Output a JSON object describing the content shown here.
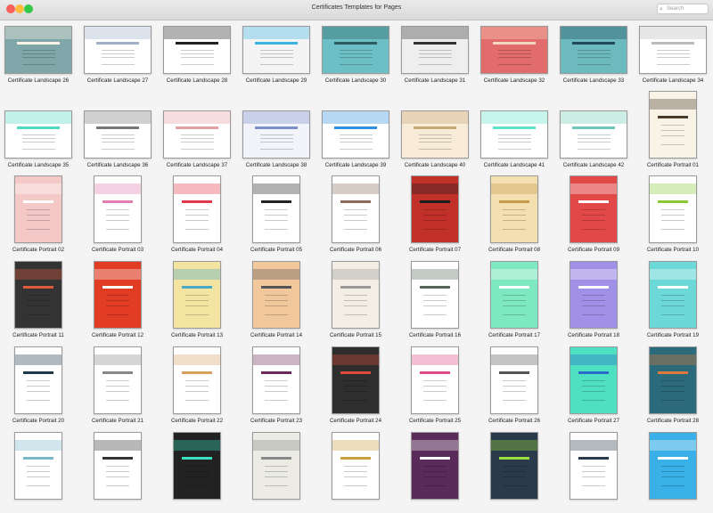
{
  "window": {
    "title": "Certificates Templates for Pages",
    "search_placeholder": "Search",
    "traffic_lights": {
      "close": "#fc605b",
      "minimize": "#fdbc40",
      "zoom": "#34c84a"
    }
  },
  "rows": [
    [
      {
        "label": "Certificate Landscape 26",
        "kind": "landscape",
        "bg": "#7fa7a9",
        "accent": "#fdf3e6"
      },
      {
        "label": "Certificate Landscape 27",
        "kind": "landscape",
        "bg": "#ffffff",
        "accent": "#9fb0c8"
      },
      {
        "label": "Certificate Landscape 28",
        "kind": "landscape",
        "bg": "#ffffff",
        "accent": "#222222"
      },
      {
        "label": "Certificate Landscape 29",
        "kind": "landscape",
        "bg": "#f4f4f4",
        "accent": "#3bb3e0"
      },
      {
        "label": "Certificate Landscape 30",
        "kind": "landscape",
        "bg": "#6cc0c5",
        "accent": "#2d5b5e"
      },
      {
        "label": "Certificate Landscape 31",
        "kind": "landscape",
        "bg": "#eeeeee",
        "accent": "#333333"
      },
      {
        "label": "Certificate Landscape 32",
        "kind": "landscape",
        "bg": "#e26b6b",
        "accent": "#f6d7c2"
      },
      {
        "label": "Certificate Landscape 33",
        "kind": "landscape",
        "bg": "#6cbabd",
        "accent": "#22475a"
      },
      {
        "label": "Certificate Landscape 34",
        "kind": "landscape",
        "bg": "#ffffff",
        "accent": "#bbbbbb"
      }
    ],
    [
      {
        "label": "Certificate Landscape 35",
        "kind": "landscape",
        "bg": "#ffffff",
        "accent": "#4fd8c2"
      },
      {
        "label": "Certificate Landscape 36",
        "kind": "landscape",
        "bg": "#ffffff",
        "accent": "#777777"
      },
      {
        "label": "Certificate Landscape 37",
        "kind": "landscape",
        "bg": "#ffffff",
        "accent": "#e4a0a0"
      },
      {
        "label": "Certificate Landscape 38",
        "kind": "landscape",
        "bg": "#f2f4fa",
        "accent": "#7b8fc8"
      },
      {
        "label": "Certificate Landscape 39",
        "kind": "landscape",
        "bg": "#ffffff",
        "accent": "#2f8fe0"
      },
      {
        "label": "Certificate Landscape 40",
        "kind": "landscape",
        "bg": "#f8ecd8",
        "accent": "#c8a878"
      },
      {
        "label": "Certificate Landscape 41",
        "kind": "landscape",
        "bg": "#ffffff",
        "accent": "#5ee2c8"
      },
      {
        "label": "Certificate Landscape 42",
        "kind": "landscape",
        "bg": "#ffffff",
        "accent": "#6cc8b8"
      },
      {
        "label": "Certificate Portrait 01",
        "kind": "portrait",
        "bg": "#f8f3e6",
        "accent": "#4a3a2a"
      }
    ],
    [
      {
        "label": "Certificate Portrait 02",
        "kind": "portrait",
        "bg": "#f5c8c8",
        "accent": "#ffffff"
      },
      {
        "label": "Certificate Portrait 03",
        "kind": "portrait",
        "bg": "#ffffff",
        "accent": "#e07fb0"
      },
      {
        "label": "Certificate Portrait 04",
        "kind": "portrait",
        "bg": "#ffffff",
        "accent": "#e03a4a"
      },
      {
        "label": "Certificate Portrait 05",
        "kind": "portrait",
        "bg": "#ffffff",
        "accent": "#222222"
      },
      {
        "label": "Certificate Portrait 06",
        "kind": "portrait",
        "bg": "#ffffff",
        "accent": "#8a6a5a"
      },
      {
        "label": "Certificate Portrait 07",
        "kind": "portrait",
        "bg": "#c2302a",
        "accent": "#1e1e1e"
      },
      {
        "label": "Certificate Portrait 08",
        "kind": "portrait",
        "bg": "#f3dfb0",
        "accent": "#c89a4a"
      },
      {
        "label": "Certificate Portrait 09",
        "kind": "portrait",
        "bg": "#e24848",
        "accent": "#ffffff"
      },
      {
        "label": "Certificate Portrait 10",
        "kind": "portrait",
        "bg": "#ffffff",
        "accent": "#8ac83a"
      }
    ],
    [
      {
        "label": "Certificate Portrait 11",
        "kind": "portrait",
        "bg": "#333333",
        "accent": "#e05a3a"
      },
      {
        "label": "Certificate Portrait 12",
        "kind": "portrait",
        "bg": "#e23c24",
        "accent": "#ffffff"
      },
      {
        "label": "Certificate Portrait 13",
        "kind": "portrait",
        "bg": "#f3e4a2",
        "accent": "#4aa8c8"
      },
      {
        "label": "Certificate Portrait 14",
        "kind": "portrait",
        "bg": "#f1c79c",
        "accent": "#555555"
      },
      {
        "label": "Certificate Portrait 15",
        "kind": "portrait",
        "bg": "#f3eee4",
        "accent": "#999999"
      },
      {
        "label": "Certificate Portrait 16",
        "kind": "portrait",
        "bg": "#ffffff",
        "accent": "#556655"
      },
      {
        "label": "Certificate Portrait 17",
        "kind": "portrait",
        "bg": "#7ee8c2",
        "accent": "#ffffff"
      },
      {
        "label": "Certificate Portrait 18",
        "kind": "portrait",
        "bg": "#a190e8",
        "accent": "#ffffff"
      },
      {
        "label": "Certificate Portrait 19",
        "kind": "portrait",
        "bg": "#6cd8d8",
        "accent": "#ffffff"
      }
    ],
    [
      {
        "label": "Certificate Portrait 20",
        "kind": "portrait",
        "bg": "#ffffff",
        "accent": "#1e3a4a"
      },
      {
        "label": "Certificate Portrait 21",
        "kind": "portrait",
        "bg": "#ffffff",
        "accent": "#888888"
      },
      {
        "label": "Certificate Portrait 22",
        "kind": "portrait",
        "bg": "#ffffff",
        "accent": "#d8a060"
      },
      {
        "label": "Certificate Portrait 23",
        "kind": "portrait",
        "bg": "#ffffff",
        "accent": "#6a2a5a"
      },
      {
        "label": "Certificate Portrait 24",
        "kind": "portrait",
        "bg": "#2e2e2e",
        "accent": "#e04a3a"
      },
      {
        "label": "Certificate Portrait 25",
        "kind": "portrait",
        "bg": "#ffffff",
        "accent": "#e04a8a"
      },
      {
        "label": "Certificate Portrait 26",
        "kind": "portrait",
        "bg": "#ffffff",
        "accent": "#555555"
      },
      {
        "label": "Certificate Portrait 27",
        "kind": "portrait",
        "bg": "#4ee0c0",
        "accent": "#2a6ac8"
      },
      {
        "label": "Certificate Portrait 28",
        "kind": "portrait",
        "bg": "#2a6a7a",
        "accent": "#e07a3a"
      }
    ],
    [
      {
        "kind": "portrait",
        "bg": "#ffffff",
        "accent": "#7ab8c8"
      },
      {
        "kind": "portrait",
        "bg": "#ffffff",
        "accent": "#333333"
      },
      {
        "kind": "portrait",
        "bg": "#222222",
        "accent": "#3ae0c0"
      },
      {
        "kind": "portrait",
        "bg": "#ecece4",
        "accent": "#888888"
      },
      {
        "kind": "portrait",
        "bg": "#ffffff",
        "accent": "#c8a040"
      },
      {
        "kind": "portrait",
        "bg": "#5a2a5a",
        "accent": "#ffffff"
      },
      {
        "kind": "portrait",
        "bg": "#2a3a4a",
        "accent": "#9ae040"
      },
      {
        "kind": "portrait",
        "bg": "#ffffff",
        "accent": "#2a3a4a"
      },
      {
        "kind": "portrait",
        "bg": "#3ab0e8",
        "accent": "#ffffff"
      }
    ]
  ]
}
